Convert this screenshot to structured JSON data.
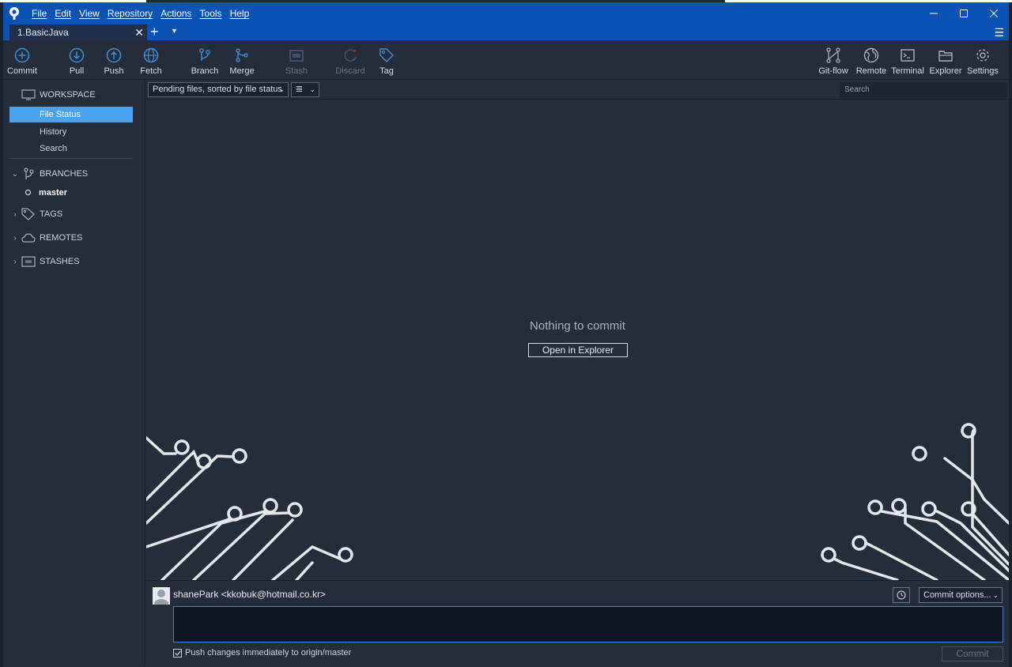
{
  "menu": [
    "File",
    "Edit",
    "View",
    "Repository",
    "Actions",
    "Tools",
    "Help"
  ],
  "tab": {
    "label": "1.BasicJava"
  },
  "toolbar": {
    "commit": "Commit",
    "pull": "Pull",
    "push": "Push",
    "fetch": "Fetch",
    "branch": "Branch",
    "merge": "Merge",
    "stash": "Stash",
    "discard": "Discard",
    "tag": "Tag",
    "gitflow": "Git-flow",
    "remote": "Remote",
    "terminal": "Terminal",
    "explorer": "Explorer",
    "settings": "Settings"
  },
  "sidebar": {
    "workspace": "WORKSPACE",
    "file_status": "File Status",
    "history": "History",
    "search": "Search",
    "branches": "BRANCHES",
    "master": "master",
    "tags": "TAGS",
    "remotes": "REMOTES",
    "stashes": "STASHES"
  },
  "main": {
    "sort": "Pending files, sorted by file status",
    "view_icon": "≣",
    "search_placeholder": "Search",
    "empty": "Nothing to commit",
    "open_explorer": "Open in Explorer"
  },
  "commit": {
    "author": "shanePark <kkobuk@hotmail.co.kr>",
    "options": "Commit options...",
    "push_label": "Push changes immediately to origin/master",
    "push_checked": true,
    "button": "Commit"
  },
  "colors": {
    "titlebar": "#0a53b5",
    "background": "#252d3a",
    "selection": "#4aa3f0",
    "icon_blue": "#3c8fd6"
  }
}
